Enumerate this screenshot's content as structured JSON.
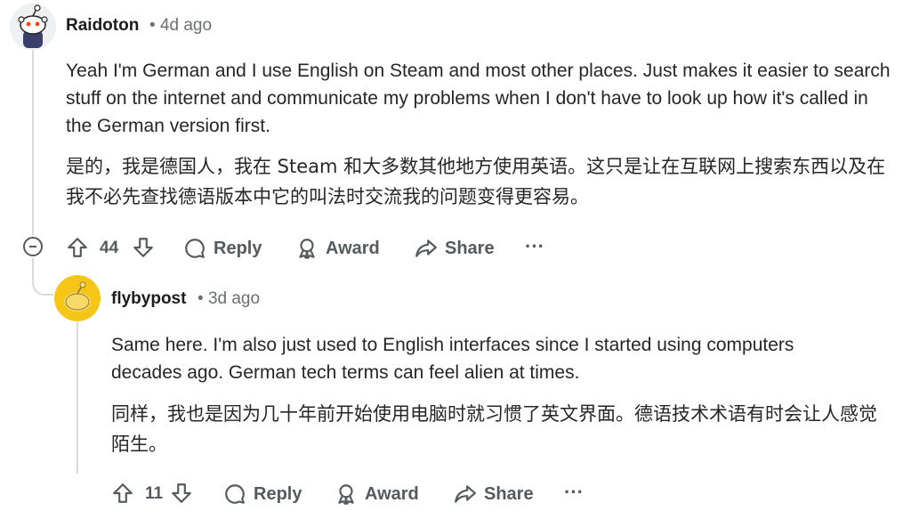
{
  "comments": [
    {
      "username": "Raidoton",
      "age": "4d ago",
      "text_en": "Yeah I'm German and I use English on Steam and most other places. Just makes it easier to search stuff on the internet and communicate my problems when I don't have to look up how it's called in the German version first.",
      "text_zh": "是的，我是德国人，我在 Steam 和大多数其他地方使用英语。这只是让在互联网上搜索东西以及在我不必先查找德语版本中它的叫法时交流我的问题变得更容易。",
      "votes": "44",
      "reply_label": "Reply",
      "award_label": "Award",
      "share_label": "Share",
      "more_label": "···",
      "avatar_color": "#ffffff"
    },
    {
      "username": "flybypost",
      "age": "3d ago",
      "text_en": "Same here. I'm also just used to English interfaces since I started using computers decades ago. German tech terms can feel alien at times.",
      "text_zh": "同样，我也是因为几十年前开始使用电脑时就习惯了英文界面。德语技术术语有时会让人感觉陌生。",
      "votes": "11",
      "reply_label": "Reply",
      "award_label": "Award",
      "share_label": "Share",
      "more_label": "···",
      "avatar_color": "#f5c518"
    }
  ],
  "colors": {
    "meta": "#6b6f72",
    "action": "#555a5e",
    "thread_line": "#d8dadc"
  }
}
